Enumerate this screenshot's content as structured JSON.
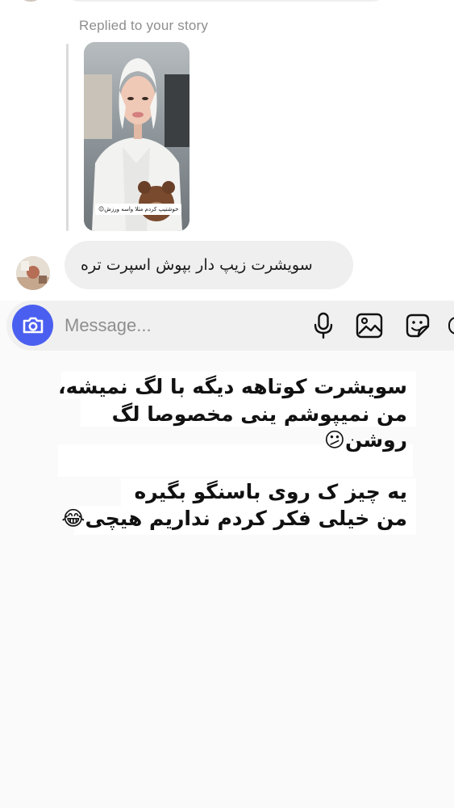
{
  "story_reply": {
    "label": "Replied to your story",
    "story_caption": "خوشتیپ کردم مثلا واسه ورزش😉"
  },
  "message": {
    "text": "سویشرت زیپ دار بپوش اسپرت تره"
  },
  "composer": {
    "placeholder": "Message...",
    "accent_color": "#4a5ff0"
  },
  "note": {
    "lines": [
      "سویشرت کوتاهه دیگه با لگ نمیشه،",
      "من نمیپوشم ینی مخصوصا لگ",
      "روشن😕",
      "یه چیز ک روی باسنگو بگیره",
      "من خیلی فکر کردم نداریم هیچی😂"
    ]
  }
}
